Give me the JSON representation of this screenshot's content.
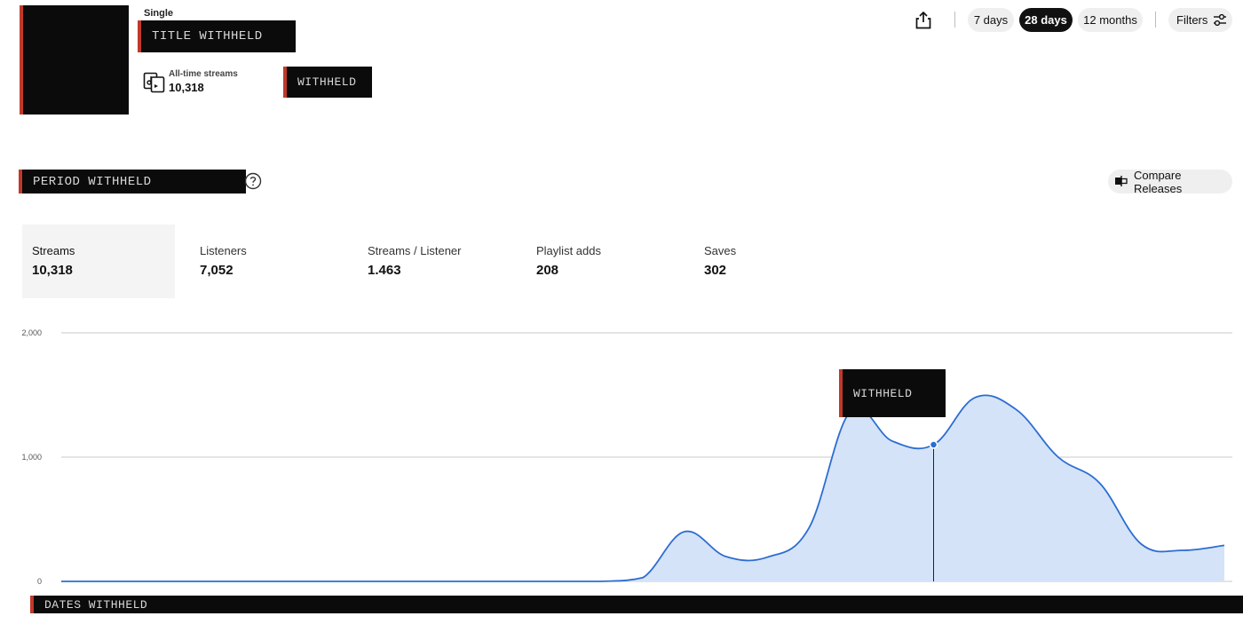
{
  "release": {
    "type_label": "Single",
    "title_redacted": "TITLE WITHHELD",
    "alltime_label": "All-time streams",
    "alltime_value": "10,318",
    "artist_redacted": "WITHHELD",
    "cover_icon": "album-cover"
  },
  "toolbar": {
    "share_icon": "share-icon",
    "ranges": [
      {
        "label": "7 days",
        "active": false
      },
      {
        "label": "28 days",
        "active": true
      },
      {
        "label": "12 months",
        "active": false
      }
    ],
    "filters_label": "Filters",
    "filters_icon": "sliders-icon"
  },
  "period": {
    "redacted": "PERIOD WITHHELD",
    "help_icon": "help-icon"
  },
  "compare": {
    "label": "Compare Releases",
    "icon": "compare-icon"
  },
  "metrics": [
    {
      "label": "Streams",
      "value": "10,318",
      "active": true
    },
    {
      "label": "Listeners",
      "value": "7,052",
      "active": false
    },
    {
      "label": "Streams / Listener",
      "value": "1.463",
      "active": false
    },
    {
      "label": "Playlist adds",
      "value": "208",
      "active": false
    },
    {
      "label": "Saves",
      "value": "302",
      "active": false
    }
  ],
  "chart": {
    "tooltip_redacted": "WITHHELD",
    "dates_redacted": "DATES WITHHELD",
    "accent_color": "#2c6dd1",
    "fill_color": "#d5e3f8"
  },
  "chart_data": {
    "type": "area",
    "title": "",
    "xlabel": "",
    "ylabel": "",
    "ylim": [
      0,
      2000
    ],
    "yticks": [
      "0",
      "1,000",
      "2,000"
    ],
    "grid": true,
    "highlight_index": 21,
    "series": [
      {
        "values": [
          0,
          0,
          0,
          0,
          0,
          0,
          0,
          0,
          0,
          0,
          0,
          0,
          0,
          0,
          30,
          400,
          200,
          195,
          430,
          1370,
          1130,
          1100,
          1480,
          1380,
          1000,
          790,
          300,
          250,
          290
        ]
      }
    ]
  }
}
